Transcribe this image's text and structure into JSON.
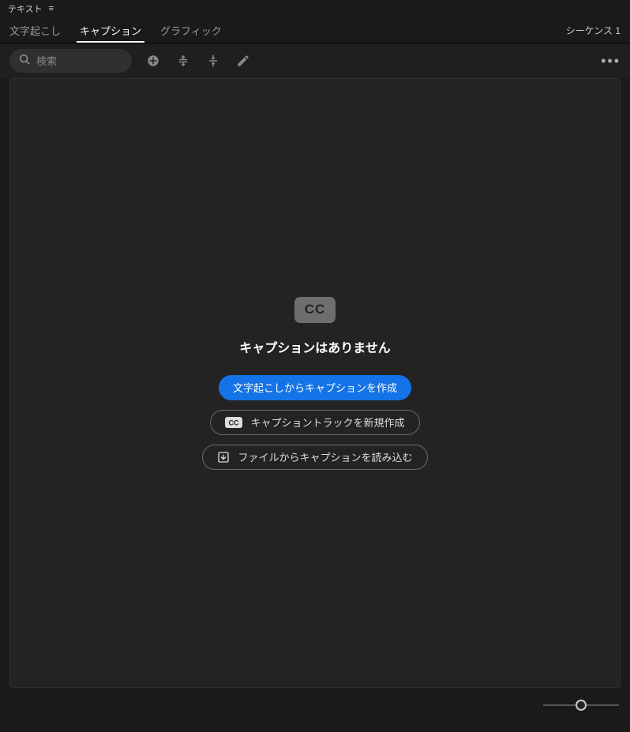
{
  "panel": {
    "title": "テキスト"
  },
  "tabs": {
    "transcribe": "文字起こし",
    "captions": "キャプション",
    "graphics": "グラフィック"
  },
  "sequence": {
    "label": "シーケンス 1"
  },
  "toolbar": {
    "search_placeholder": "検索"
  },
  "empty": {
    "cc_badge": "CC",
    "cc_small": "CC",
    "title": "キャプションはありません",
    "create_from_transcript": "文字起こしからキャプションを作成",
    "create_track": "キャプショントラックを新規作成",
    "import_file": "ファイルからキャプションを読み込む"
  }
}
